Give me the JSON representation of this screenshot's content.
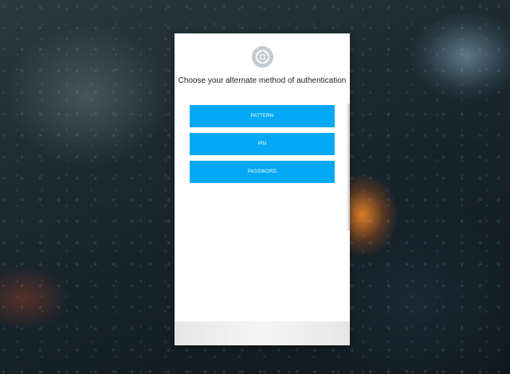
{
  "background": {
    "description_color": "#1d2a30",
    "accent_light_color": "#ff8c28"
  },
  "dialog": {
    "logo_icon": "lifebuoy-icon",
    "title": "Choose your alternate method of authentication",
    "buttons": [
      {
        "label": "PATTERN"
      },
      {
        "label": "PIN"
      },
      {
        "label": "PASSWORD"
      }
    ]
  },
  "colors": {
    "primary_button": "#03a9f4",
    "button_text": "#ffffff",
    "logo_bg": "#c3cbd1"
  }
}
